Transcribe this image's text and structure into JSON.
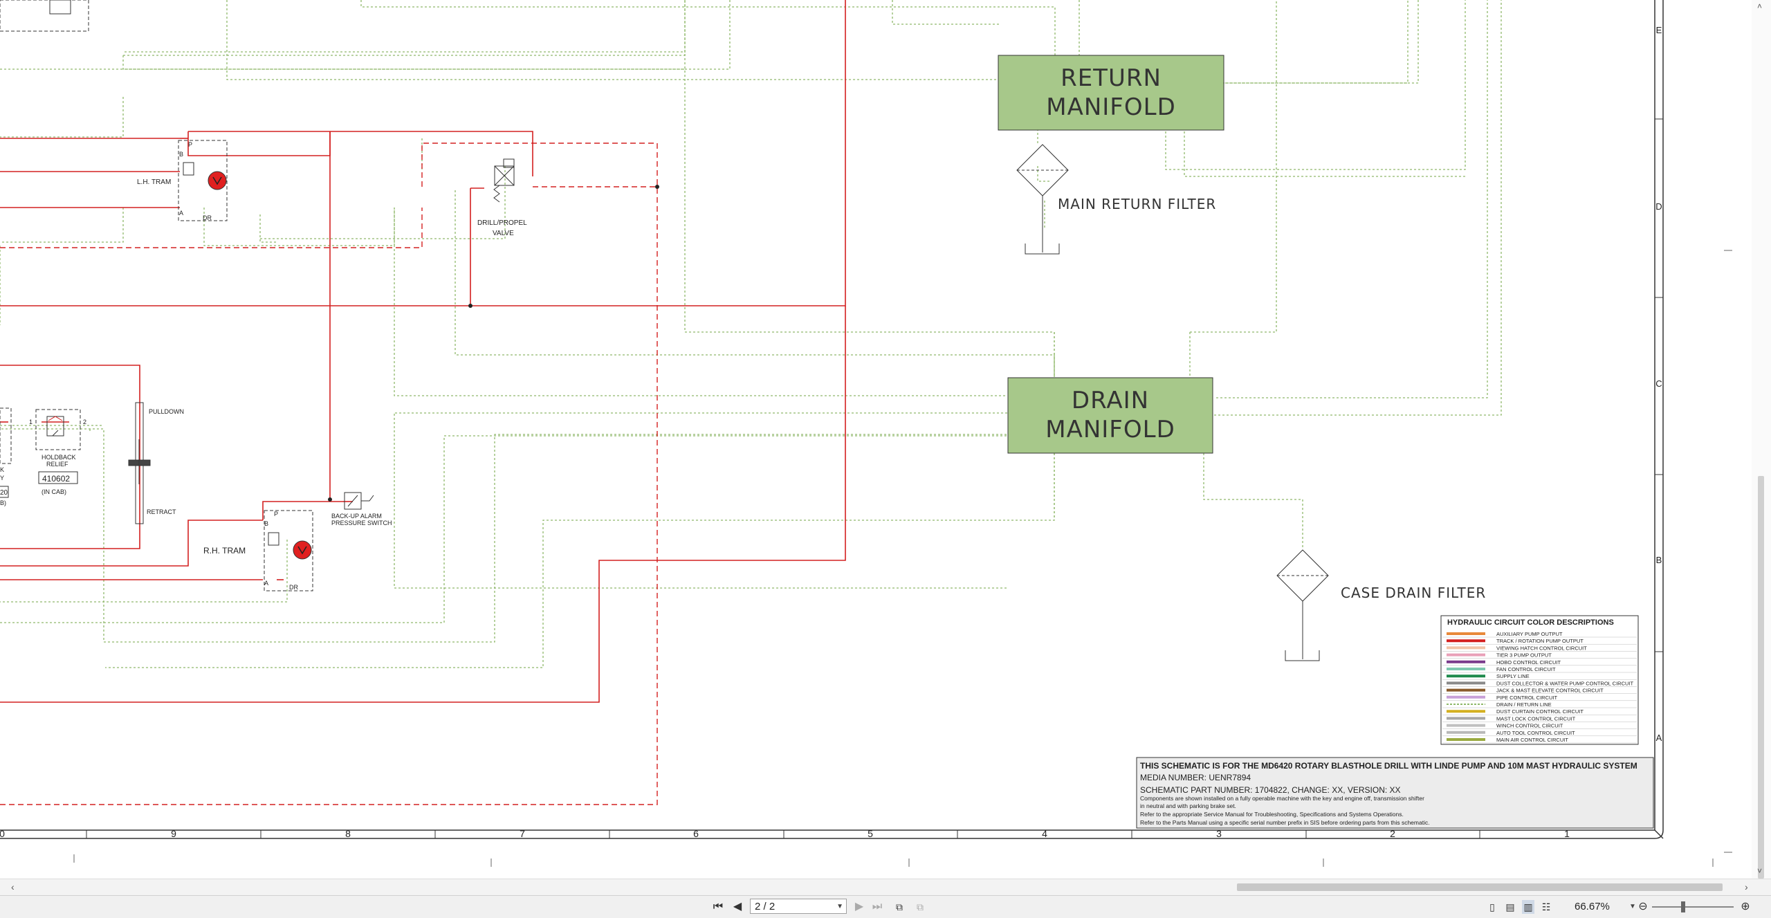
{
  "document": {
    "blocks": {
      "return_manifold": [
        "RETURN",
        "MANIFOLD"
      ],
      "drain_manifold": [
        "DRAIN",
        "MANIFOLD"
      ]
    },
    "labels": {
      "main_return_filter": "MAIN RETURN FILTER",
      "case_drain_filter": "CASE DRAIN FILTER",
      "lh_tram": "L.H. TRAM",
      "rh_tram": "R.H. TRAM",
      "drill_propel_valve": [
        "DRILL/PROPEL",
        "VALVE"
      ],
      "pulldown": "PULLDOWN",
      "retract": "RETRACT",
      "holdback_relief": [
        "HOLDBACK",
        "RELIEF"
      ],
      "holdback_part": "410602",
      "in_cab": "(IN CAB)",
      "backup_alarm": [
        "BACK-UP ALARM",
        "PRESSURE SWITCH"
      ],
      "port_1": "1",
      "port_2": "2",
      "port_p": "P",
      "port_b": "B",
      "port_a": "A",
      "port_dr": "DR",
      "cut_fragments": [
        "K",
        "Y",
        "20",
        "B)"
      ]
    },
    "grid_columns": [
      "0",
      "9",
      "8",
      "7",
      "6",
      "5",
      "4",
      "3",
      "2",
      "1"
    ],
    "grid_rows": [
      "E",
      "D",
      "C",
      "B",
      "A"
    ],
    "legend": {
      "title": "HYDRAULIC CIRCUIT COLOR DESCRIPTIONS",
      "items": [
        {
          "label": "AUXILIARY PUMP OUTPUT",
          "color": "#e8893a",
          "dashed": false
        },
        {
          "label": "TRACK / ROTATION PUMP OUTPUT",
          "color": "#d42020",
          "dashed": false
        },
        {
          "label": "VIEWING HATCH CONTROL CIRCUIT",
          "color": "#f2c4a8",
          "dashed": false
        },
        {
          "label": "TIER 3 PUMP OUTPUT",
          "color": "#e9a0b8",
          "dashed": false
        },
        {
          "label": "HOBO CONTROL CIRCUIT",
          "color": "#7a3a8c",
          "dashed": false
        },
        {
          "label": "FAN CONTROL CIRCUIT",
          "color": "#7ec8b0",
          "dashed": false
        },
        {
          "label": "SUPPLY LINE",
          "color": "#1f8a4c",
          "dashed": false
        },
        {
          "label": "DUST COLLECTOR & WATER PUMP CONTROL CIRCUIT",
          "color": "#8a8a8a",
          "dashed": false
        },
        {
          "label": "JACK & MAST ELEVATE CONTROL CIRCUIT",
          "color": "#8a5a2a",
          "dashed": false
        },
        {
          "label": "PIPE CONTROL CIRCUIT",
          "color": "#c8a0d8",
          "dashed": false
        },
        {
          "label": "DRAIN / RETURN LINE",
          "color": "#8fb86a",
          "dashed": true
        },
        {
          "label": "DUST CURTAIN CONTROL CIRCUIT",
          "color": "#d4b020",
          "dashed": false
        },
        {
          "label": "MAST LOCK CONTROL CIRCUIT",
          "color": "#a8a8a8",
          "dashed": false
        },
        {
          "label": "WINCH CONTROL CIRCUIT",
          "color": "#c0c0c0",
          "dashed": false
        },
        {
          "label": "AUTO TOOL CONTROL CIRCUIT",
          "color": "#b8b8b8",
          "dashed": false
        },
        {
          "label": "MAIN AIR CONTROL CIRCUIT",
          "color": "#9aaa40",
          "dashed": false
        }
      ]
    },
    "title_block": {
      "line1": "THIS SCHEMATIC IS FOR THE MD6420 ROTARY BLASTHOLE DRILL WITH LINDE PUMP AND 10M MAST HYDRAULIC SYSTEM",
      "line2": "MEDIA NUMBER: UENR7894",
      "line3": "SCHEMATIC PART NUMBER: 1704822, CHANGE: XX, VERSION: XX",
      "notes": [
        "Components are shown installed on a fully operable machine with the key and engine off, transmission shifter",
        "in neutral and with parking brake set.",
        "Refer to the appropriate Service Manual for Troubleshooting, Specifications and Systems Operations.",
        "Refer to the Parts Manual using a specific serial number prefix in SIS before ordering parts from this schematic."
      ]
    }
  },
  "viewer": {
    "page_indicator": "2 / 2",
    "zoom_level": "66.67%",
    "icons": {
      "first": "first-page-icon",
      "prev": "prev-page-icon",
      "next": "next-page-icon",
      "last": "last-page-icon"
    }
  },
  "colors": {
    "hydraulic_red": "#d42020",
    "drain_green": "#8fb86a",
    "manifold_fill": "#a7c88a",
    "valve_red": "#e02020"
  }
}
